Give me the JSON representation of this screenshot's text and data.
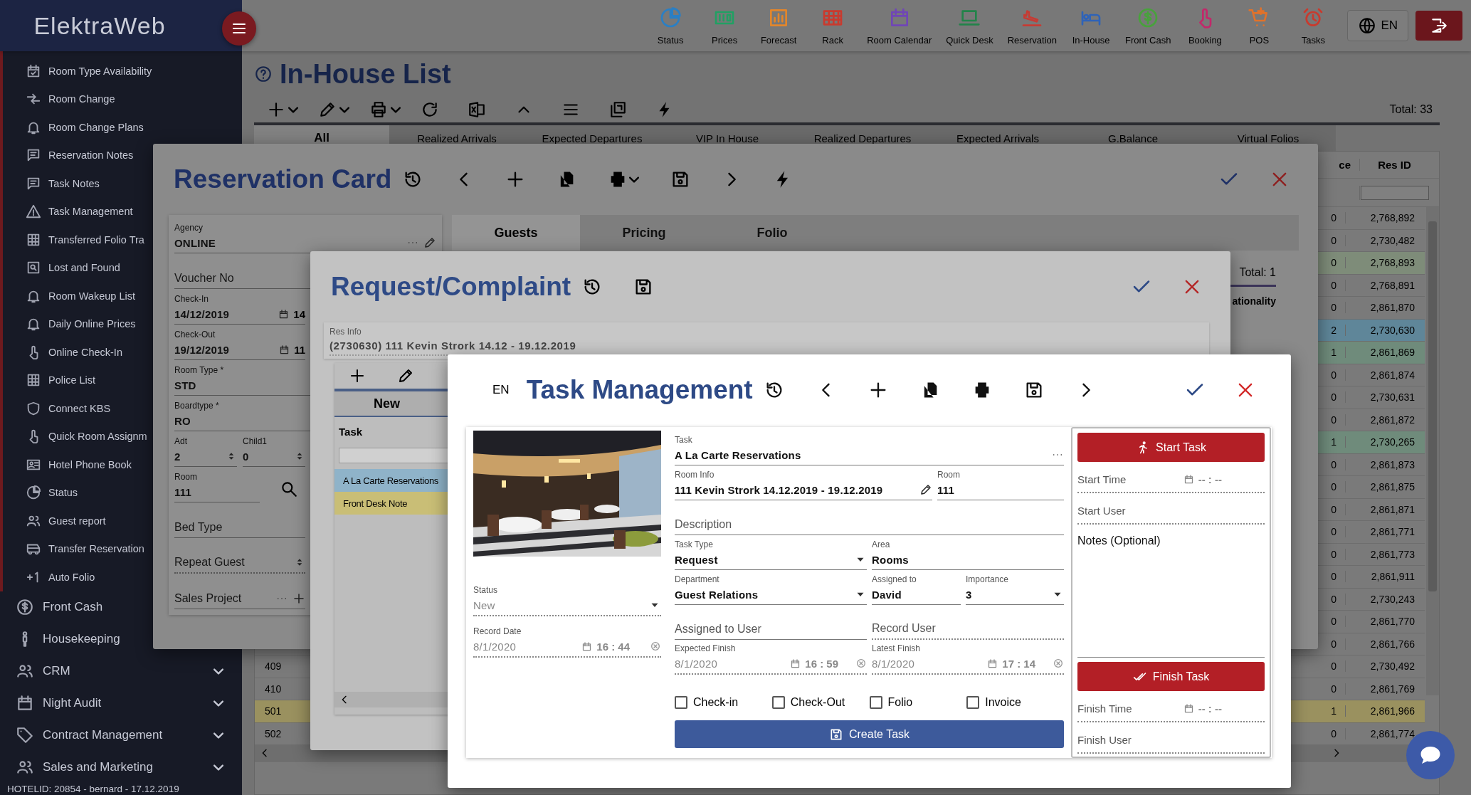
{
  "header": {
    "logo": "ElektraWeb",
    "language": "EN"
  },
  "top_nav": [
    {
      "label": "Status"
    },
    {
      "label": "Prices"
    },
    {
      "label": "Forecast"
    },
    {
      "label": "Rack"
    },
    {
      "label": "Room Calendar"
    },
    {
      "label": "Quick Desk"
    },
    {
      "label": "Reservation"
    },
    {
      "label": "In-House"
    },
    {
      "label": "Front Cash"
    },
    {
      "label": "Booking"
    },
    {
      "label": "POS"
    },
    {
      "label": "Tasks"
    }
  ],
  "sidebar": {
    "items": [
      {
        "label": "Room Type Availability",
        "kind": "sub"
      },
      {
        "label": "Room Change",
        "kind": "sub"
      },
      {
        "label": "Room Change Plans",
        "kind": "sub"
      },
      {
        "label": "Reservation Notes",
        "kind": "sub"
      },
      {
        "label": "Task Notes",
        "kind": "sub"
      },
      {
        "label": "Task Management",
        "kind": "sub"
      },
      {
        "label": "Transferred Folio Tra",
        "kind": "sub"
      },
      {
        "label": "Lost and Found",
        "kind": "sub"
      },
      {
        "label": "Room Wakeup List",
        "kind": "sub"
      },
      {
        "label": "Daily Online Prices",
        "kind": "sub"
      },
      {
        "label": "Online Check-In",
        "kind": "sub"
      },
      {
        "label": "Police List",
        "kind": "sub"
      },
      {
        "label": "Connect KBS",
        "kind": "sub"
      },
      {
        "label": "Quick Room Assignm",
        "kind": "sub"
      },
      {
        "label": "Hotel Phone Book",
        "kind": "sub"
      },
      {
        "label": "Status",
        "kind": "sub"
      },
      {
        "label": "Guest report",
        "kind": "sub"
      },
      {
        "label": "Transfer Reservation",
        "kind": "sub"
      },
      {
        "label": "Auto Folio",
        "kind": "sub"
      },
      {
        "label": "Front Cash",
        "kind": "link"
      },
      {
        "label": "Housekeeping",
        "kind": "link"
      },
      {
        "label": "CRM",
        "kind": "group",
        "expanded": false
      },
      {
        "label": "Night Audit",
        "kind": "group",
        "expanded": false
      },
      {
        "label": "Contract Management",
        "kind": "group",
        "expanded": false
      },
      {
        "label": "Sales and Marketing",
        "kind": "group",
        "expanded": false
      }
    ],
    "footer": "HOTELID: 20854 - bernard - 17.12.2019"
  },
  "in_house": {
    "title": "In-House List",
    "total": "Total: 33",
    "tabs": [
      {
        "label": "All",
        "selected": true
      },
      {
        "label": "Realized Arrivals",
        "selected": false
      },
      {
        "label": "Expected Departures",
        "selected": false
      },
      {
        "label": "VIP In House",
        "selected": false
      },
      {
        "label": "Realized Departures",
        "selected": false
      },
      {
        "label": "Expected Arrivals",
        "selected": false
      },
      {
        "label": "G.Balance",
        "selected": false
      },
      {
        "label": "Virtual Folios",
        "selected": false
      }
    ],
    "columns": [
      "ce",
      "Res ID"
    ],
    "rows": [
      {
        "balance": "0",
        "res_id": "2,768,892"
      },
      {
        "balance": "0",
        "res_id": "2,730,482"
      },
      {
        "balance": "0",
        "res_id": "2,768,893",
        "color": "#7e8c79"
      },
      {
        "balance": "0",
        "res_id": "2,768,891"
      },
      {
        "balance": "0",
        "res_id": "2,861,870"
      },
      {
        "balance": "2",
        "res_id": "2,730,630",
        "color": "#5f8699"
      },
      {
        "balance": "1",
        "res_id": "2,861,869",
        "color": "#6f8b7b"
      },
      {
        "balance": "0",
        "res_id": "2,861,874"
      },
      {
        "balance": "0",
        "res_id": "2,730,631"
      },
      {
        "balance": "0",
        "res_id": "2,861,872"
      },
      {
        "balance": "1",
        "res_id": "2,730,265",
        "color": "#6f8b7b"
      },
      {
        "balance": "0",
        "res_id": "2,861,873"
      },
      {
        "balance": "0",
        "res_id": "2,861,875"
      },
      {
        "balance": "0",
        "res_id": "2,861,871"
      },
      {
        "balance": "0",
        "res_id": "2,861,771"
      },
      {
        "balance": "0",
        "res_id": "2,861,773"
      },
      {
        "balance": "0",
        "res_id": "2,861,911"
      },
      {
        "balance": "0",
        "res_id": "2,730,243"
      },
      {
        "balance": "0",
        "res_id": "2,861,770"
      },
      {
        "balance": "0",
        "res_id": "2,861,766"
      },
      {
        "room": "409",
        "balance": "0",
        "res_id": "2,730,492"
      },
      {
        "room": "410",
        "balance": "0",
        "res_id": "2,861,769"
      },
      {
        "room": "501",
        "balance": "1",
        "res_id": "2,861,966",
        "color": "#9a915f"
      },
      {
        "room": "502",
        "balance": "0",
        "res_id": "2,861,774"
      }
    ]
  },
  "reservation_card": {
    "title": "Reservation Card",
    "agency": {
      "label": "Agency",
      "value": "ONLINE"
    },
    "voucher": {
      "placeholder": "Voucher No"
    },
    "check_in": {
      "label": "Check-In",
      "value": "14/12/2019",
      "time": "14"
    },
    "check_out": {
      "label": "Check-Out",
      "value": "19/12/2019",
      "time": "11"
    },
    "room_type": {
      "label": "Room Type *",
      "value": "STD"
    },
    "boardtype": {
      "label": "Boardtype *",
      "value": "RO"
    },
    "adults": {
      "label": "Adt",
      "value": "2"
    },
    "children": {
      "label": "Child1",
      "value": "0"
    },
    "room": {
      "label": "Room",
      "value": "111"
    },
    "bed_type": {
      "placeholder": "Bed Type"
    },
    "repeat_guest": {
      "placeholder": "Repeat Guest"
    },
    "sales_project": {
      "placeholder": "Sales Project"
    },
    "tabs": [
      {
        "label": "Guests",
        "selected": true
      },
      {
        "label": "Pricing",
        "selected": false
      },
      {
        "label": "Folio",
        "selected": false
      }
    ],
    "total": "Total: 1",
    "columns": [
      "ationality"
    ]
  },
  "request_complaint": {
    "title": "Request/Complaint",
    "res_info": {
      "label": "Res Info",
      "value": "(2730630) 111 Kevin Strork 14.12 - 19.12.2019"
    },
    "list": {
      "header": "New",
      "column": "Task",
      "items": [
        {
          "label": "A La Carte Reservations",
          "color": "#8fb3c9"
        },
        {
          "label": "Front Desk Note",
          "color": "#c9be76"
        }
      ]
    }
  },
  "task_management": {
    "language": "EN",
    "title": "Task Management",
    "status": {
      "label": "Status",
      "value": "New",
      "disabled": true
    },
    "record_date": {
      "label": "Record Date",
      "date": "8/1/2020",
      "time": "16 : 44"
    },
    "task": {
      "label": "Task",
      "value": "A La Carte Reservations"
    },
    "room_info": {
      "label": "Room Info",
      "value": "111 Kevin Strork 14.12.2019 - 19.12.2019"
    },
    "room": {
      "label": "Room",
      "value": "111"
    },
    "description": {
      "placeholder": "Description"
    },
    "task_type": {
      "label": "Task Type",
      "value": "Request"
    },
    "area": {
      "label": "Area",
      "value": "Rooms"
    },
    "department": {
      "label": "Department",
      "value": "Guest Relations"
    },
    "assigned_to": {
      "label": "Assigned to",
      "value": "David"
    },
    "importance": {
      "label": "Importance",
      "value": "3"
    },
    "assigned_user": {
      "placeholder": "Assigned to User"
    },
    "record_user": {
      "placeholder": "Record User"
    },
    "expected_finish": {
      "label": "Expected Finish",
      "date": "8/1/2020",
      "time": "16 : 59"
    },
    "latest_finish": {
      "label": "Latest Finish",
      "date": "8/1/2020",
      "time": "17 : 14"
    },
    "options": [
      {
        "label": "Check-in",
        "checked": false
      },
      {
        "label": "Check-Out",
        "checked": false
      },
      {
        "label": "Folio",
        "checked": false
      },
      {
        "label": "Invoice",
        "checked": false
      }
    ],
    "create_button": "Create Task",
    "start_button": "Start Task",
    "start_time": {
      "placeholder": "Start Time",
      "time": "-- : --"
    },
    "start_user": {
      "placeholder": "Start User"
    },
    "notes": {
      "placeholder": "Notes (Optional)"
    },
    "finish_button": "Finish Task",
    "finish_time": {
      "placeholder": "Finish Time",
      "time": "-- : --"
    },
    "finish_user": {
      "placeholder": "Finish User"
    }
  }
}
